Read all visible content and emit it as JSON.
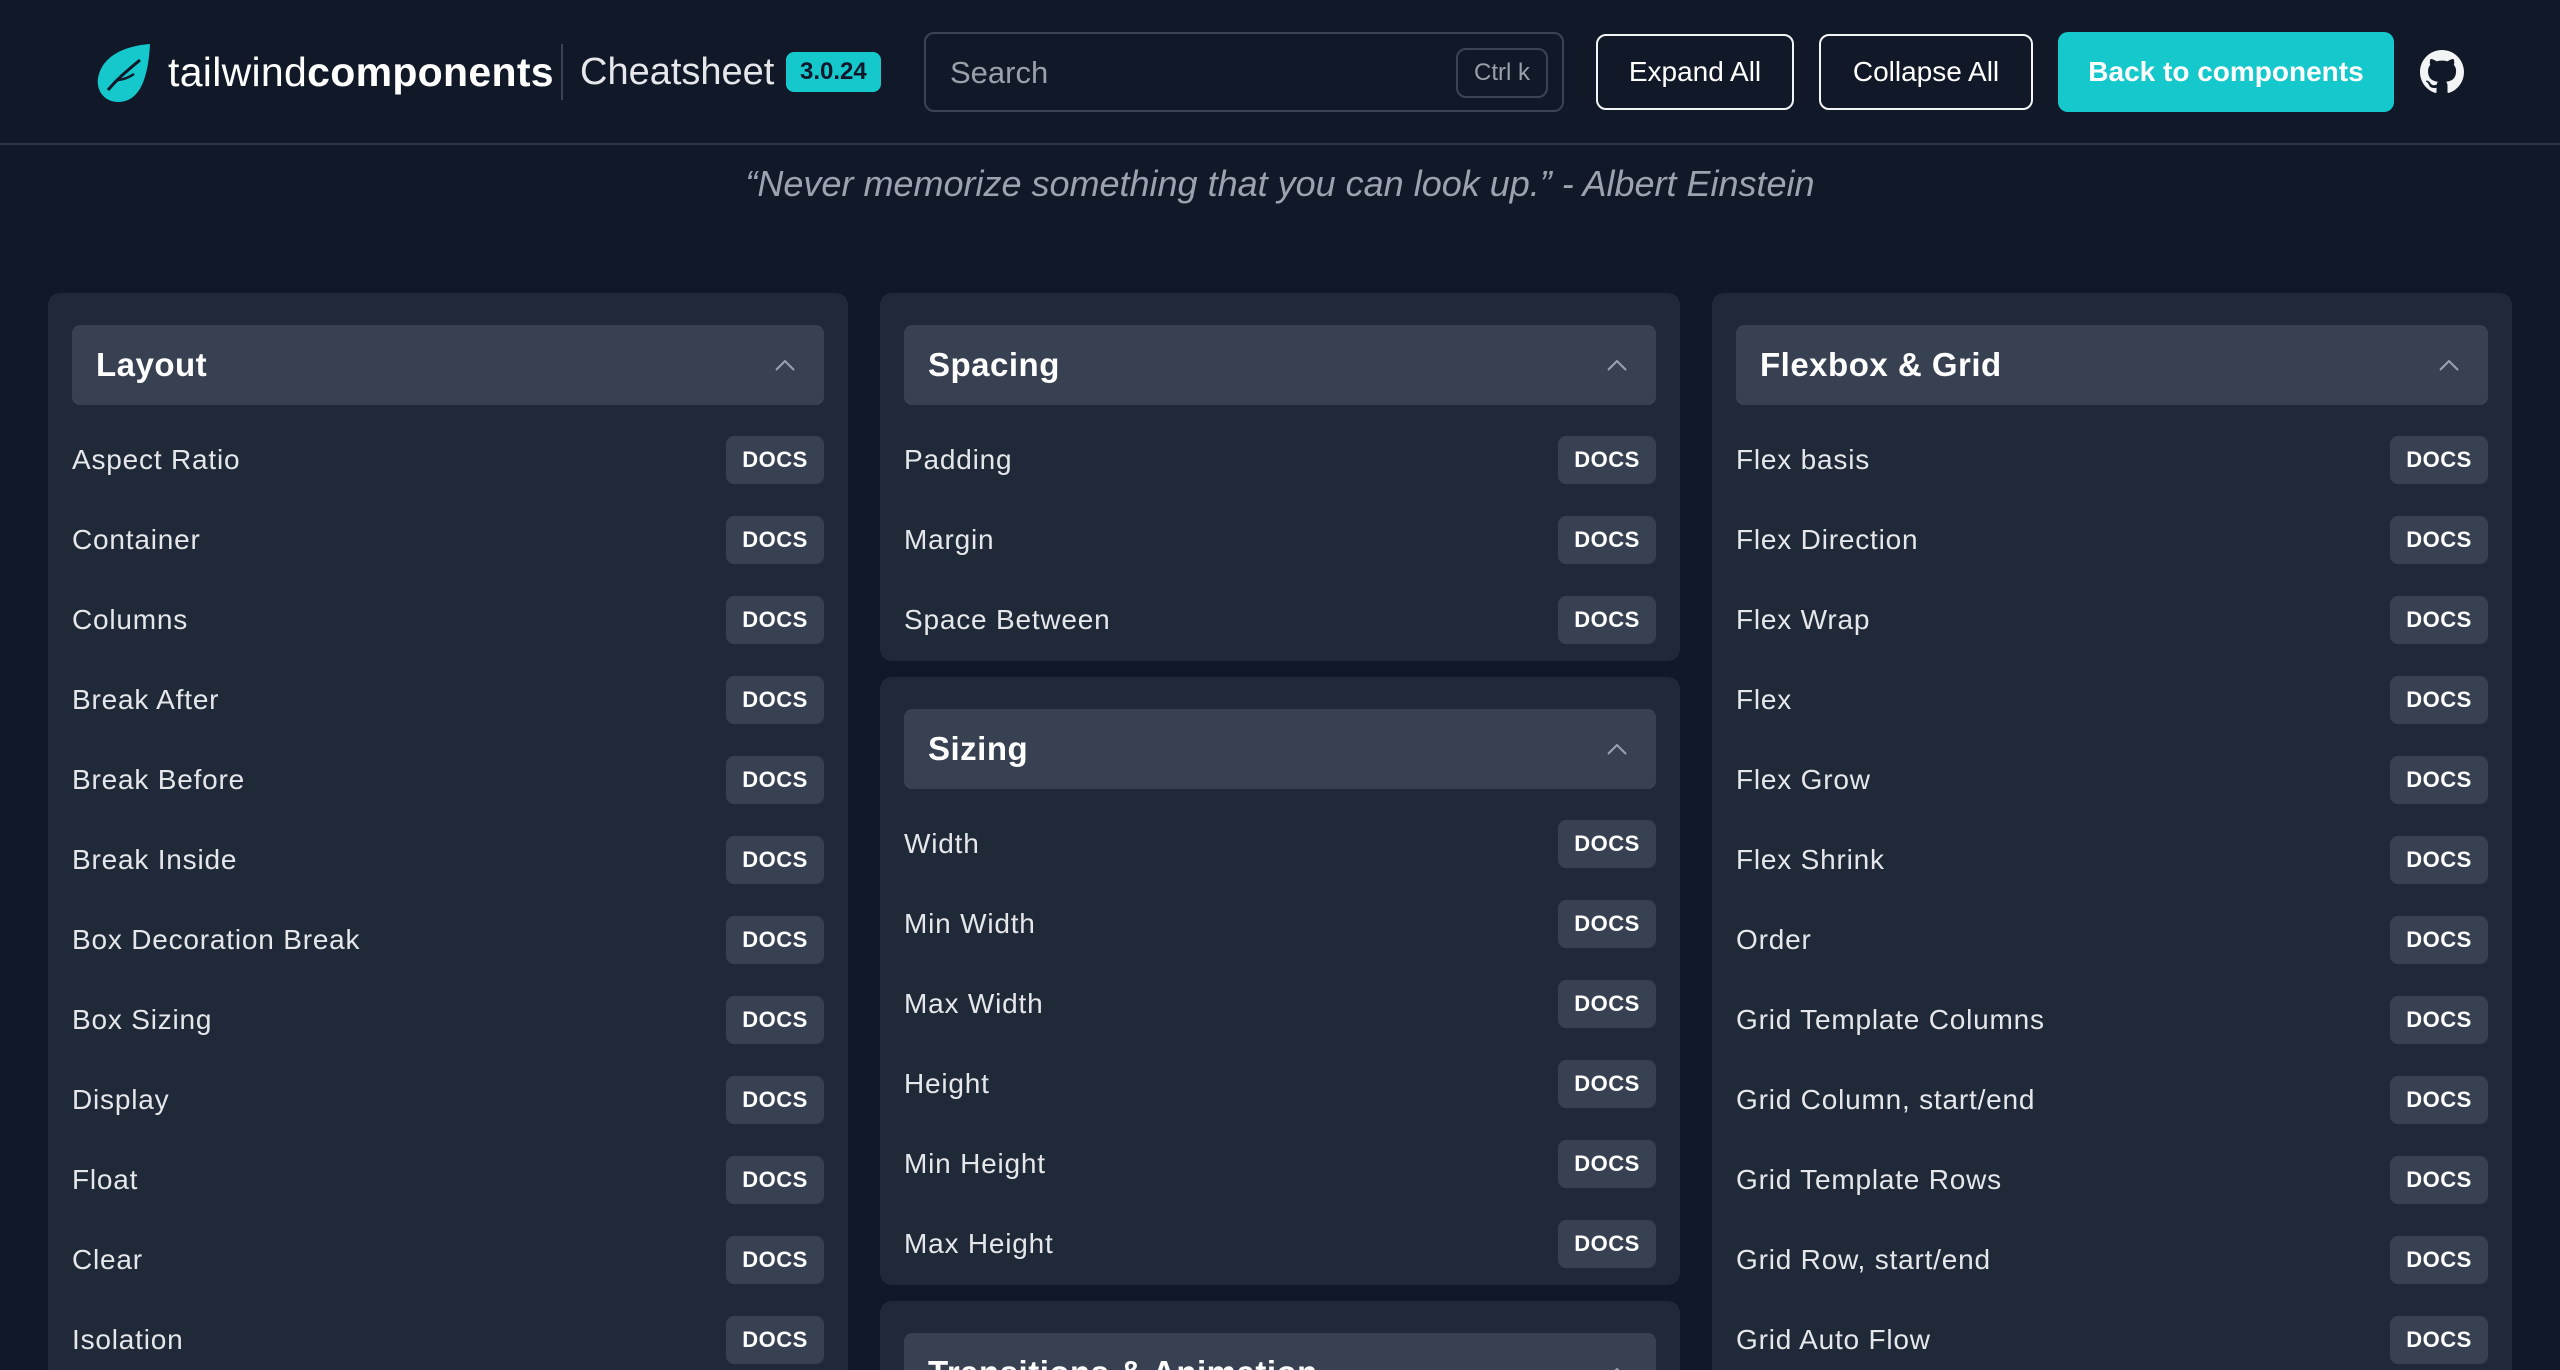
{
  "header": {
    "brand_light": "tailwind",
    "brand_bold": "components",
    "title": "Cheatsheet",
    "version": "3.0.24",
    "search": {
      "placeholder": "Search",
      "shortcut": "Ctrl k"
    },
    "expand_label": "Expand All",
    "collapse_label": "Collapse All",
    "back_label": "Back to components",
    "icons": {
      "logo": "tailwind-leaf-icon",
      "github": "github-icon"
    },
    "colors": {
      "accent": "#14c8cc",
      "background": "#111827",
      "card": "#1f2937",
      "card_header": "#374151"
    }
  },
  "quote": "“Never memorize something that you can look up.” - Albert Einstein",
  "docs_label": "DOCS",
  "sections": {
    "layout": {
      "title": "Layout",
      "items": [
        "Aspect Ratio",
        "Container",
        "Columns",
        "Break After",
        "Break Before",
        "Break Inside",
        "Box Decoration Break",
        "Box Sizing",
        "Display",
        "Float",
        "Clear",
        "Isolation"
      ]
    },
    "spacing": {
      "title": "Spacing",
      "items": [
        "Padding",
        "Margin",
        "Space Between"
      ]
    },
    "sizing": {
      "title": "Sizing",
      "items": [
        "Width",
        "Min Width",
        "Max Width",
        "Height",
        "Min Height",
        "Max Height"
      ]
    },
    "transitions": {
      "title": "Transitions & Animation"
    },
    "flexbox": {
      "title": "Flexbox & Grid",
      "items": [
        "Flex basis",
        "Flex Direction",
        "Flex Wrap",
        "Flex",
        "Flex Grow",
        "Flex Shrink",
        "Order",
        "Grid Template Columns",
        "Grid Column, start/end",
        "Grid Template Rows",
        "Grid Row, start/end",
        "Grid Auto Flow"
      ]
    }
  }
}
